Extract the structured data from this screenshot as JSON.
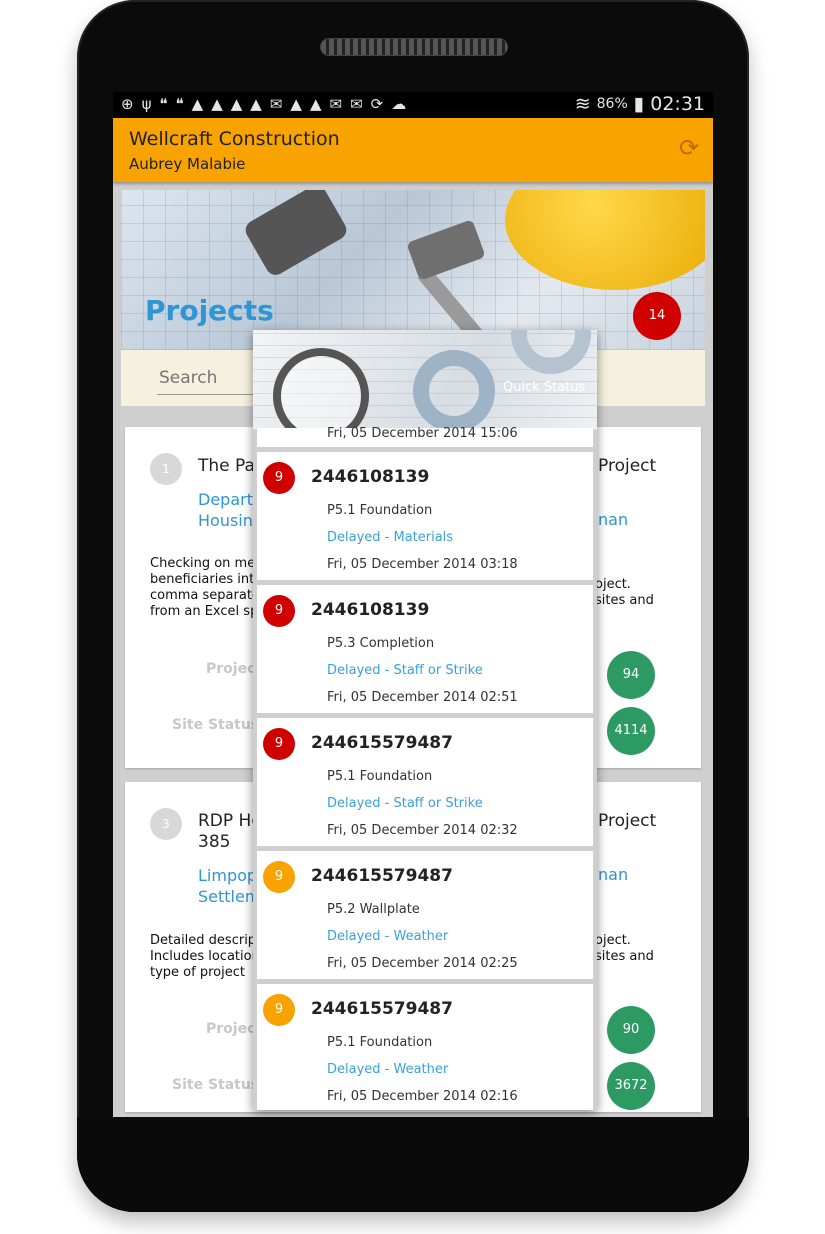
{
  "status_bar": {
    "battery": "86%",
    "time": "02:31"
  },
  "app_bar": {
    "title": "Wellcraft Construction",
    "subtitle": "Aubrey Malabie"
  },
  "header": {
    "title": "Projects",
    "count": "14"
  },
  "search": {
    "placeholder": "Search"
  },
  "cards": [
    {
      "number": "1",
      "title_left": "The Pa",
      "title_right": "Project",
      "location_left_line1": "Departi",
      "location_left_line2": "Housin",
      "location_right": "nan",
      "description_left": [
        "Checking on met",
        "beneficiaries into",
        "comma separate",
        "from an Excel sp"
      ],
      "description_right": [
        "oject.",
        "sites and"
      ],
      "label_project": "Project",
      "label_site_status": "Site Status",
      "project_count": "94",
      "site_status_count": "4114"
    },
    {
      "number": "3",
      "title_left_line1": "RDP Ho",
      "title_left_line2": "385",
      "title_right": "Project",
      "location_left_line1": "Limpop",
      "location_left_line2": "Settlem",
      "location_right": "nan",
      "description_left": [
        "Detailed descripti",
        "Includes location",
        "type of project"
      ],
      "description_right": [
        "oject.",
        "sites and"
      ],
      "label_project": "Project",
      "label_site_status": "Site Status",
      "project_count": "90",
      "site_status_count": "3672"
    }
  ],
  "quick_status": {
    "title": "Quick Status",
    "top_partial_time": "Fri, 05 December 2014 15:06",
    "events": [
      {
        "badge": "9",
        "badge_color": "#d00000",
        "id": "2446108139",
        "phase": "P5.1 Foundation",
        "reason": "Delayed - Materials",
        "time": "Fri, 05 December 2014 03:18"
      },
      {
        "badge": "9",
        "badge_color": "#d00000",
        "id": "2446108139",
        "phase": "P5.3 Completion",
        "reason": "Delayed - Staff or Strike",
        "time": "Fri, 05 December 2014 02:51"
      },
      {
        "badge": "9",
        "badge_color": "#d00000",
        "id": "244615579487",
        "phase": "P5.1 Foundation",
        "reason": "Delayed - Staff or Strike",
        "time": "Fri, 05 December 2014 02:32"
      },
      {
        "badge": "9",
        "badge_color": "#f8a300",
        "id": "244615579487",
        "phase": "P5.2 Wallplate",
        "reason": "Delayed - Weather",
        "time": "Fri, 05 December 2014 02:25"
      },
      {
        "badge": "9",
        "badge_color": "#f8a300",
        "id": "244615579487",
        "phase": "P5.1 Foundation",
        "reason": "Delayed - Weather",
        "time": "Fri, 05 December 2014 02:16"
      }
    ]
  }
}
